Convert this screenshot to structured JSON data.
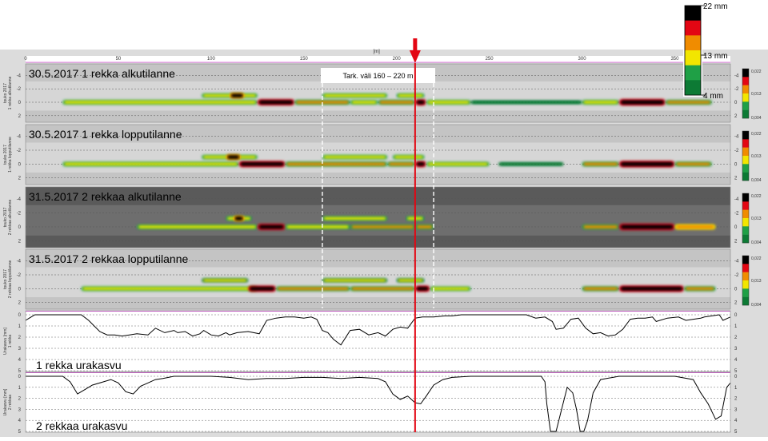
{
  "colors": {
    "light_green": "#1fa046",
    "dark_green": "#0c7a34",
    "yellow": "#f2e600",
    "orange": "#f08c00",
    "red": "#e30613",
    "black": "#000000",
    "marker": "#e30613",
    "gray_band": "#a8a8a8",
    "dark_band": "#5a5a5a",
    "pink_frame": "#d94fd9"
  },
  "chart_data": [
    {
      "type": "heatmap",
      "id": "legend",
      "title": "",
      "labels": [
        "22 mm",
        "13 mm",
        "4 mm"
      ],
      "levels": [
        22,
        13,
        4
      ],
      "colors": [
        "#000000",
        "#e30613",
        "#f08c00",
        "#f2e600",
        "#1fa046",
        "#0c7a34"
      ]
    },
    {
      "type": "heatmap",
      "id": "x-axis",
      "unit": "[m]",
      "ticks": [
        0,
        50,
        100,
        150,
        200,
        250,
        300,
        350
      ],
      "xlim": [
        0,
        380
      ]
    },
    {
      "type": "heatmap",
      "id": "marker",
      "annotation": "Tark. väli 160 – 220 m",
      "range": [
        160,
        220
      ],
      "marker_x": 210
    },
    {
      "type": "heatmap",
      "title": "30.5.2017 1 rekka alkutilanne",
      "ylabel": "1 rekka alkutilanne",
      "ylabel_prefix": "touko 2017",
      "yticks": [
        -4,
        -2,
        0,
        2
      ],
      "colorbar_ticks": [
        "0,022",
        "0,013",
        "0,004"
      ],
      "background": "light",
      "bands": [
        {
          "y": 0,
          "segments": [
            [
              20,
              125,
              0.5
            ],
            [
              125,
              145,
              0.9
            ],
            [
              145,
              175,
              0.6
            ],
            [
              175,
              190,
              0.5
            ],
            [
              190,
              210,
              0.6
            ],
            [
              210,
              216,
              0.95
            ],
            [
              216,
              240,
              0.5
            ],
            [
              240,
              300,
              0.2
            ],
            [
              300,
              320,
              0.5
            ],
            [
              320,
              345,
              1.0
            ],
            [
              345,
              370,
              0.55
            ]
          ]
        },
        {
          "y": -1,
          "segments": [
            [
              95,
              125,
              0.45
            ],
            [
              110,
              118,
              0.85
            ],
            [
              160,
              195,
              0.45
            ],
            [
              200,
              215,
              0.45
            ]
          ]
        }
      ]
    },
    {
      "type": "heatmap",
      "title": "30.5.2017  1 rekka lopputilanne",
      "ylabel": "1 rekka lopputilanne",
      "ylabel_prefix": "touko 2017",
      "yticks": [
        -4,
        -2,
        0,
        2
      ],
      "colorbar_ticks": [
        "0,022",
        "0,013",
        "0,004"
      ],
      "background": "light",
      "bands": [
        {
          "y": 0,
          "segments": [
            [
              20,
              115,
              0.5
            ],
            [
              115,
              140,
              0.9
            ],
            [
              140,
              195,
              0.6
            ],
            [
              195,
              210,
              0.55
            ],
            [
              210,
              216,
              0.9
            ],
            [
              216,
              250,
              0.45
            ],
            [
              255,
              290,
              0.2
            ],
            [
              300,
              320,
              0.55
            ],
            [
              320,
              350,
              1.0
            ],
            [
              350,
              370,
              0.55
            ]
          ]
        },
        {
          "y": -1,
          "segments": [
            [
              95,
              125,
              0.45
            ],
            [
              108,
              116,
              0.85
            ],
            [
              160,
              195,
              0.45
            ],
            [
              198,
              215,
              0.45
            ]
          ]
        }
      ]
    },
    {
      "type": "heatmap",
      "title": "31.5.2017 2 rekkaa alkutilanne",
      "ylabel": "2 rekkaa alkutilanne",
      "ylabel_prefix": "touko 2017",
      "yticks": [
        -4,
        -2,
        0,
        2
      ],
      "colorbar_ticks": [
        "0,022",
        "0,013",
        "0,004"
      ],
      "background": "dark",
      "bands": [
        {
          "y": 0,
          "segments": [
            [
              60,
              125,
              0.5
            ],
            [
              125,
              140,
              0.9
            ],
            [
              140,
              175,
              0.5
            ],
            [
              175,
              210,
              0.55
            ],
            [
              210,
              220,
              0.6
            ],
            [
              300,
              320,
              0.6
            ],
            [
              320,
              350,
              1.0
            ],
            [
              350,
              372,
              0.65
            ]
          ]
        },
        {
          "y": -1.2,
          "segments": [
            [
              108,
              122,
              0.5
            ],
            [
              112,
              118,
              0.85
            ],
            [
              160,
              195,
              0.45
            ],
            [
              205,
              215,
              0.45
            ]
          ]
        }
      ]
    },
    {
      "type": "heatmap",
      "title": "31.5.2017  2 rekkaa lopputilanne",
      "ylabel": "2 rekkaa lopputilanne",
      "ylabel_prefix": "touko 2017",
      "yticks": [
        -4,
        -2,
        0,
        2
      ],
      "colorbar_ticks": [
        "0,022",
        "0,013",
        "0,004"
      ],
      "background": "light",
      "bands": [
        {
          "y": 0,
          "segments": [
            [
              30,
              125,
              0.5
            ],
            [
              120,
              135,
              0.9
            ],
            [
              135,
              175,
              0.55
            ],
            [
              175,
              210,
              0.55
            ],
            [
              210,
              218,
              0.9
            ],
            [
              218,
              240,
              0.45
            ],
            [
              300,
              320,
              0.55
            ],
            [
              320,
              355,
              0.95
            ],
            [
              355,
              372,
              0.55
            ]
          ]
        },
        {
          "y": -1.2,
          "segments": [
            [
              95,
              120,
              0.4
            ],
            [
              160,
              195,
              0.4
            ],
            [
              200,
              215,
              0.4
            ]
          ]
        }
      ]
    },
    {
      "type": "line",
      "title": "1 rekka urakasvu",
      "ylabel": "Urakasvu [mm]",
      "ylabel_line2": "1 rekka",
      "yticks": [
        0,
        1,
        2,
        3,
        4,
        5
      ],
      "ylim": [
        0,
        5
      ],
      "x": [
        0,
        2,
        5,
        30,
        34,
        40,
        44,
        48,
        52,
        56,
        60,
        66,
        70,
        75,
        80,
        82,
        86,
        90,
        94,
        96,
        100,
        104,
        108,
        110,
        114,
        120,
        126,
        130,
        135,
        140,
        145,
        150,
        154,
        157,
        160,
        163,
        166,
        170,
        175,
        180,
        185,
        190,
        194,
        198,
        202,
        206,
        210,
        214,
        220,
        226,
        230,
        235,
        238,
        242,
        246,
        250,
        254,
        258,
        262,
        266,
        270,
        275,
        280,
        284,
        286,
        290,
        294,
        298,
        302,
        306,
        310,
        314,
        318,
        322,
        326,
        330,
        334,
        338,
        340,
        346,
        352,
        356,
        360,
        364,
        366,
        370,
        374,
        376,
        380
      ],
      "y": [
        0.5,
        0.3,
        0,
        0,
        0.5,
        1.5,
        1.8,
        1.8,
        1.9,
        1.8,
        1.7,
        1.8,
        1.2,
        1.6,
        1.4,
        1.6,
        1.5,
        1.9,
        1.7,
        1.4,
        1.8,
        1.9,
        1.6,
        1.8,
        1.6,
        1.5,
        1.7,
        0.5,
        0.3,
        0.2,
        0.2,
        0.3,
        0.2,
        0.4,
        1.4,
        1.6,
        2.2,
        2.7,
        1.4,
        1.3,
        1.8,
        1.6,
        1.9,
        1.3,
        1.1,
        1.2,
        0.3,
        0.2,
        0.2,
        0.1,
        0.1,
        0,
        0,
        0,
        0,
        0,
        0,
        0,
        0,
        0,
        0,
        0.3,
        0.2,
        0.6,
        1.3,
        1.2,
        0.4,
        0.3,
        1.2,
        1.7,
        1.6,
        1.9,
        1.8,
        1.3,
        0.4,
        0.3,
        0.3,
        0.2,
        0.6,
        0.3,
        0.2,
        0.5,
        0.4,
        0.3,
        0.2,
        0.1,
        0,
        0.5,
        0.2
      ]
    },
    {
      "type": "line",
      "title": "2 rekkaa urakasvu",
      "ylabel": "Urakasvu [mm]",
      "ylabel_line2": "2 rekkaa",
      "yticks": [
        0,
        1,
        2,
        3,
        4,
        5
      ],
      "ylim": [
        0,
        5
      ],
      "x": [
        0,
        5,
        10,
        20,
        24,
        28,
        32,
        36,
        42,
        46,
        50,
        54,
        58,
        62,
        66,
        70,
        74,
        80,
        90,
        100,
        110,
        120,
        130,
        140,
        150,
        160,
        170,
        180,
        190,
        194,
        198,
        202,
        206,
        210,
        213,
        216,
        220,
        225,
        230,
        240,
        250,
        260,
        270,
        275,
        278,
        280,
        281,
        283,
        286,
        289,
        292,
        295,
        297,
        299,
        301,
        303,
        306,
        310,
        320,
        330,
        340,
        350,
        360,
        364,
        368,
        372,
        375,
        378,
        380
      ],
      "y": [
        0,
        0,
        0,
        0,
        0.5,
        1.6,
        1.2,
        0.8,
        0.5,
        0.3,
        0.6,
        1.4,
        1.6,
        0.9,
        0.6,
        0.3,
        0.2,
        0,
        0,
        0,
        0.1,
        0.3,
        0.2,
        0.2,
        0.1,
        0.1,
        0.2,
        0.1,
        0.2,
        0.5,
        1.6,
        2.1,
        1.8,
        2.4,
        2.5,
        1.8,
        0.8,
        0.3,
        0.1,
        0,
        0,
        0,
        0,
        0,
        0,
        0.5,
        2.5,
        5,
        5,
        3,
        1,
        1.5,
        3,
        5,
        5,
        4,
        1.5,
        0.3,
        0,
        0,
        0,
        0,
        0.3,
        1.5,
        2.5,
        3.9,
        3.6,
        1,
        0.6
      ]
    }
  ]
}
